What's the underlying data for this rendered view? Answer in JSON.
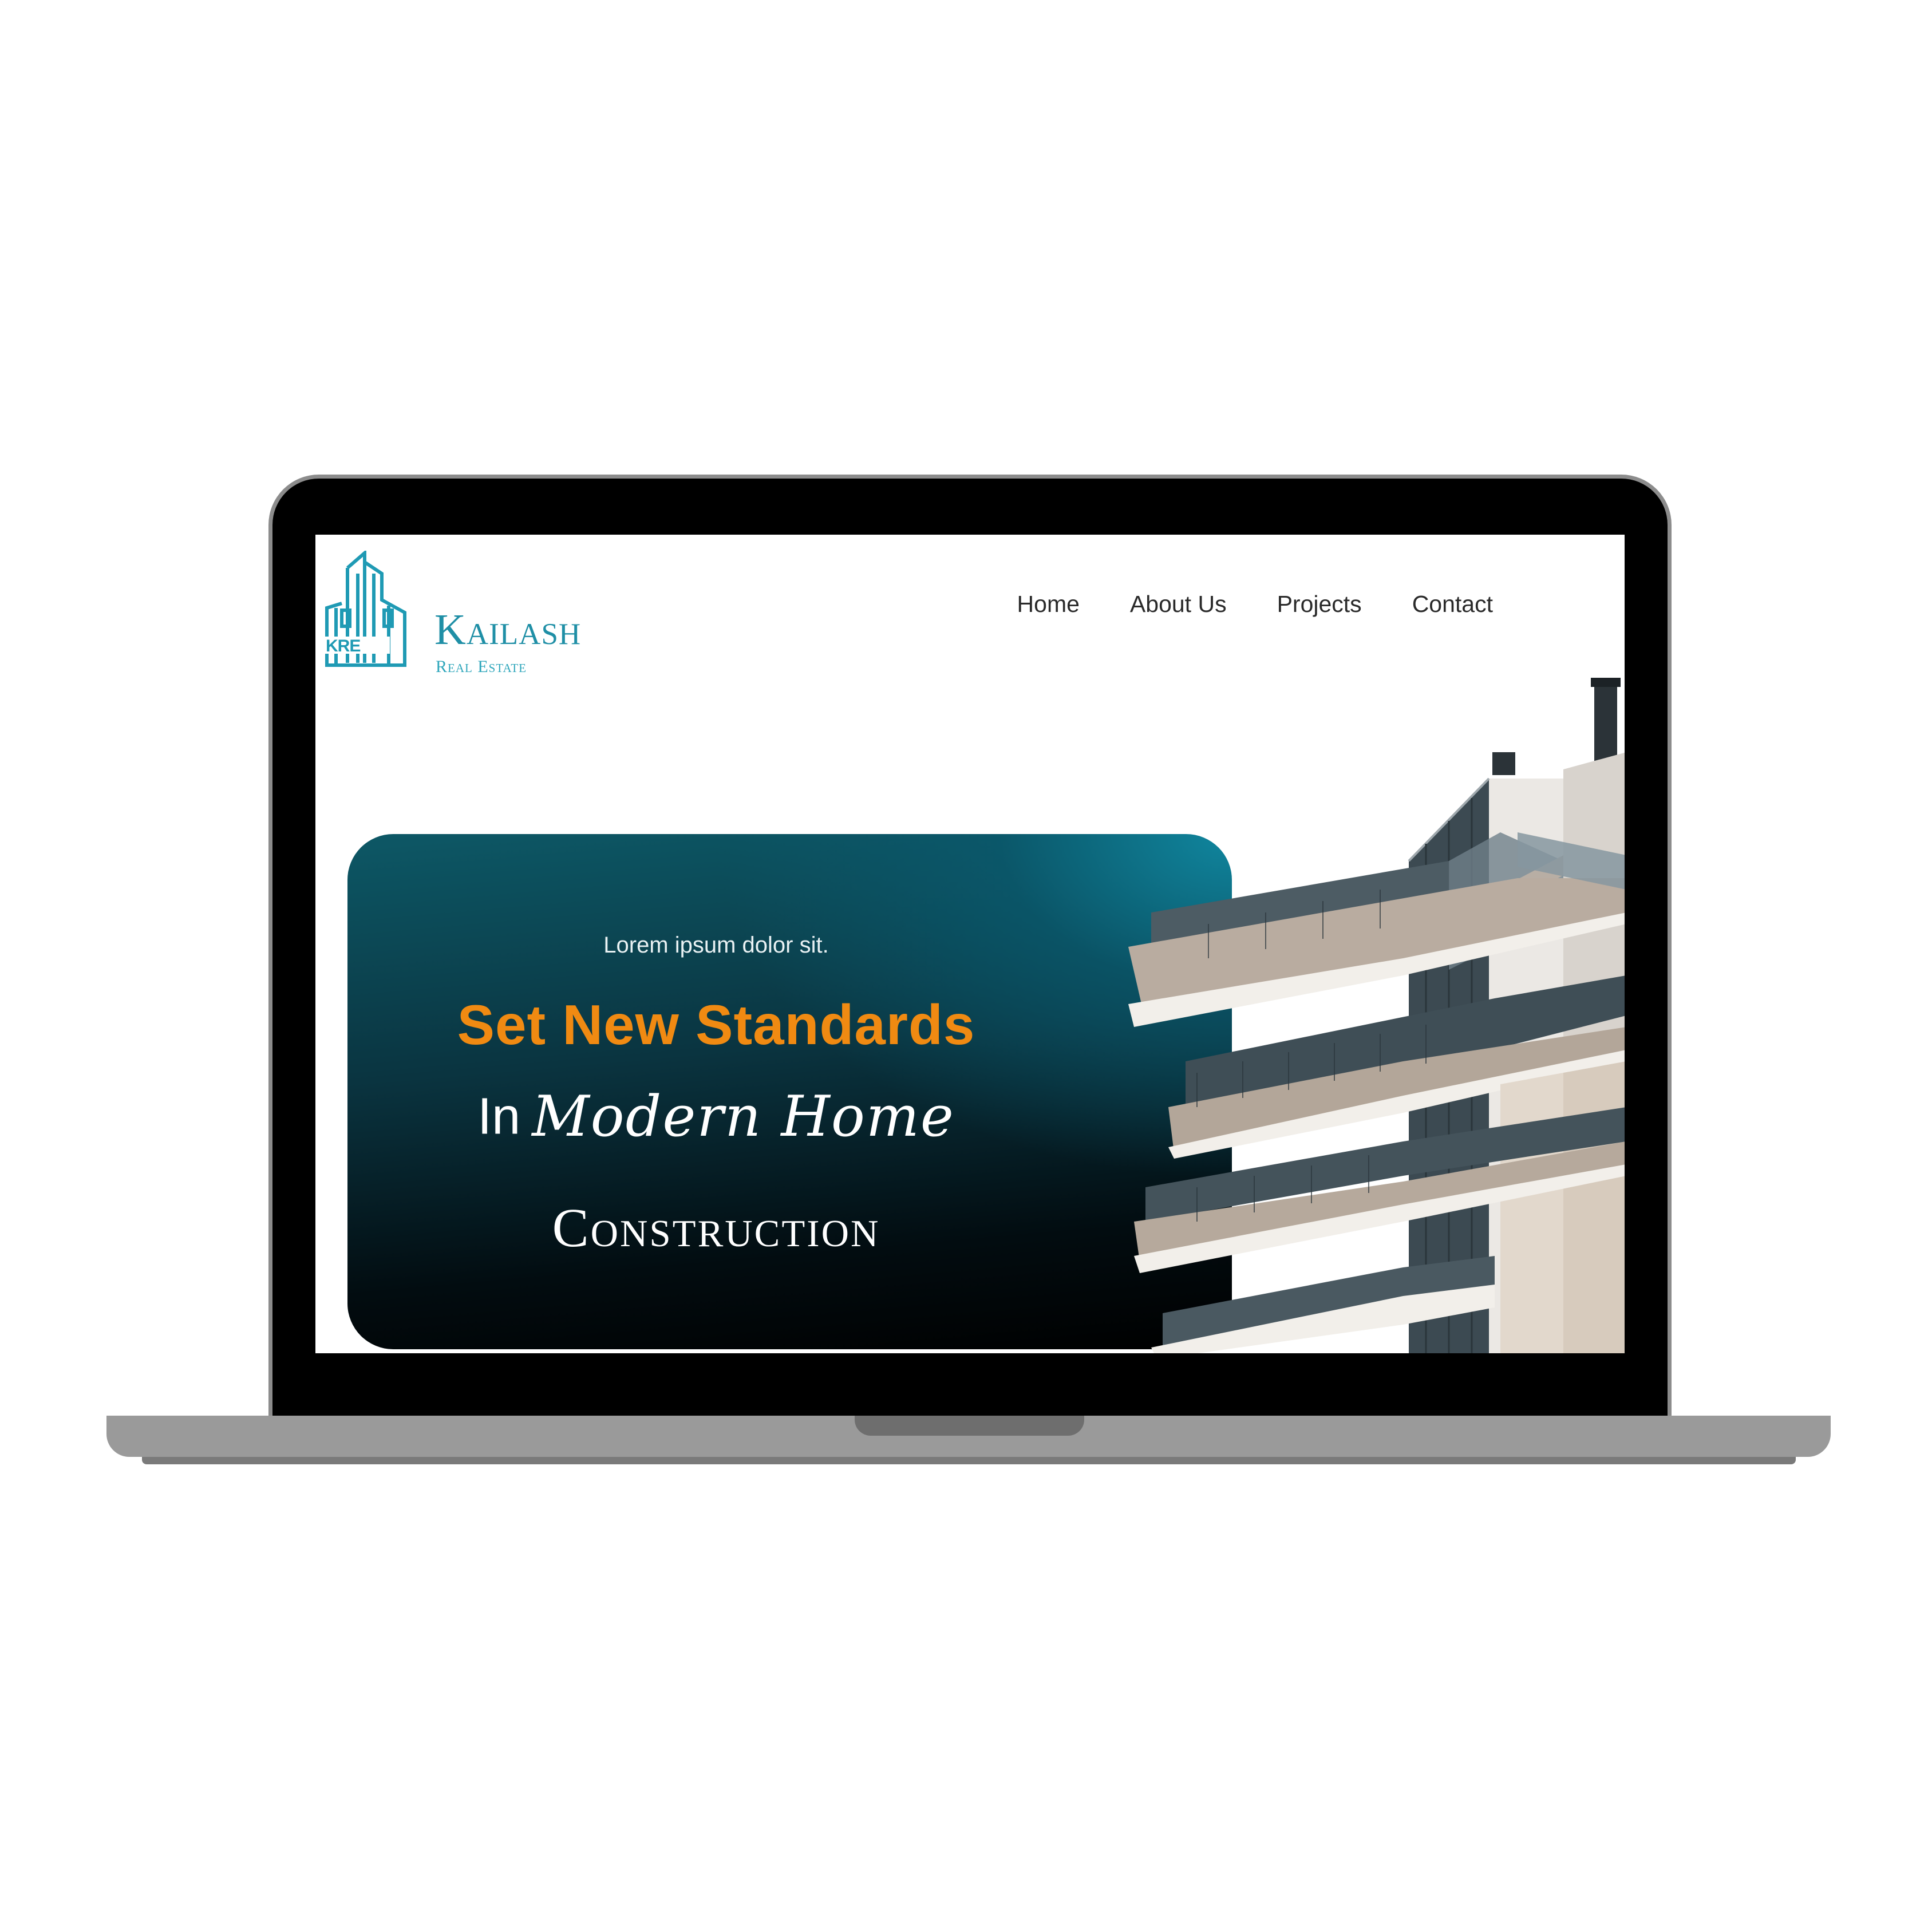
{
  "brand": {
    "name": "Kailash",
    "tagline": "Real Estate",
    "mark_letters": "KRE",
    "color": "#1f8fa6"
  },
  "nav": {
    "items": [
      {
        "label": "Home"
      },
      {
        "label": "About Us"
      },
      {
        "label": "Projects"
      },
      {
        "label": "Contact"
      }
    ]
  },
  "hero": {
    "eyebrow": "Lorem ipsum dolor sit.",
    "line1": "Set New Standards",
    "line2_plain": "In",
    "line2_script": "Modern Home",
    "line3": "Construction",
    "accent_color": "#f08a12",
    "card_color": "#0a3440"
  }
}
